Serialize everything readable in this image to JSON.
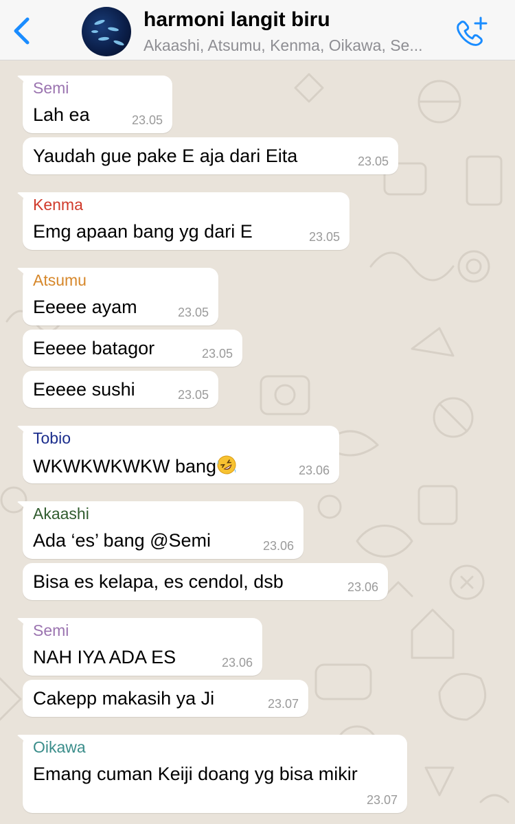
{
  "header": {
    "back_label": "",
    "title": "harmoni langit biru",
    "subtitle": "Akaashi, Atsumu, Kenma, Oikawa, Se..."
  },
  "colors": {
    "accent": "#1a8cff",
    "Semi": "#9b74b0",
    "Kenma": "#d03a2b",
    "Atsumu": "#d6872a",
    "Tobio": "#1b2d8c",
    "Akaashi": "#2f5b2d",
    "Oikawa": "#3a8d8a"
  },
  "messages": [
    {
      "sender": "Semi",
      "text": "Lah ea",
      "time": "23.05"
    },
    {
      "sender": "",
      "text": "Yaudah gue pake E aja dari Eita",
      "time": "23.05"
    },
    {
      "sender": "Kenma",
      "text": "Emg apaan bang yg dari E",
      "time": "23.05"
    },
    {
      "sender": "Atsumu",
      "text": "Eeeee ayam",
      "time": "23.05"
    },
    {
      "sender": "",
      "text": "Eeeee batagor",
      "time": "23.05"
    },
    {
      "sender": "",
      "text": "Eeeee sushi",
      "time": "23.05"
    },
    {
      "sender": "Tobio",
      "text": "WKWKWKWKW bang",
      "emoji": "rolling-on-floor-laughing-icon",
      "time": "23.06"
    },
    {
      "sender": "Akaashi",
      "text": "Ada ‘es’ bang @Semi",
      "time": "23.06"
    },
    {
      "sender": "",
      "text": "Bisa es kelapa, es cendol, dsb",
      "time": "23.06"
    },
    {
      "sender": "Semi",
      "text": "NAH IYA ADA ES",
      "time": "23.06"
    },
    {
      "sender": "",
      "text": "Cakepp makasih ya Ji",
      "time": "23.07"
    },
    {
      "sender": "Oikawa",
      "text": "Emang cuman Keiji doang yg bisa mikir",
      "time": "23.07"
    }
  ]
}
